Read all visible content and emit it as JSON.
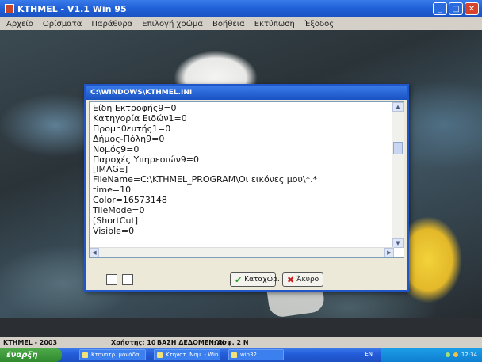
{
  "window": {
    "title": "KTHMEL - V1.1 Win 95",
    "menu": [
      "Αρχείο",
      "Ορίσματα",
      "Παράθυρα",
      "Επιλογή χρώμα",
      "Βοήθεια",
      "Εκτύπωση",
      "Έξοδος"
    ]
  },
  "dialog": {
    "title": "C:\\WINDOWS\\KTHMEL.INI",
    "lines": [
      "Είδη Εκτροφής9=0",
      "Κατηγορία Ειδών1=0",
      "Προμηθευτής1=0",
      "Δήμος-Πόλη9=0",
      "Νομός9=0",
      "Παροχές Υπηρεσιών9=0",
      "[IMAGE]",
      "FileName=C:\\KTHMEL_PROGRAM\\Οι εικόνες μου\\*.*",
      "time=10",
      "Color=16573148",
      "TileMode=0",
      "[ShortCut]",
      "Visible=0"
    ],
    "buttons": {
      "save_label": "Καταχώρ.",
      "cancel_label": "Άκυρο"
    }
  },
  "statusbar": {
    "left": "KTHMEL - 2003",
    "items": [
      "Χρήστης: 10",
      "ΒΑΣΗ ΔΕΔΟΜΕΝΩΝ",
      "Ασφ. 2 Ν"
    ]
  },
  "taskbar": {
    "start_label": "έναρξη",
    "tasks": [
      "Κτηνοτρ. μονάδα",
      "Κτηνοτ. Νομ. - Win",
      "win32"
    ],
    "language": "EN",
    "clock": "12:34"
  },
  "colors": {
    "titlebar": "#1f5fd6",
    "dialog_bg": "#ece9d8",
    "taskbar": "#245edb",
    "start": "#2f8a2f"
  }
}
